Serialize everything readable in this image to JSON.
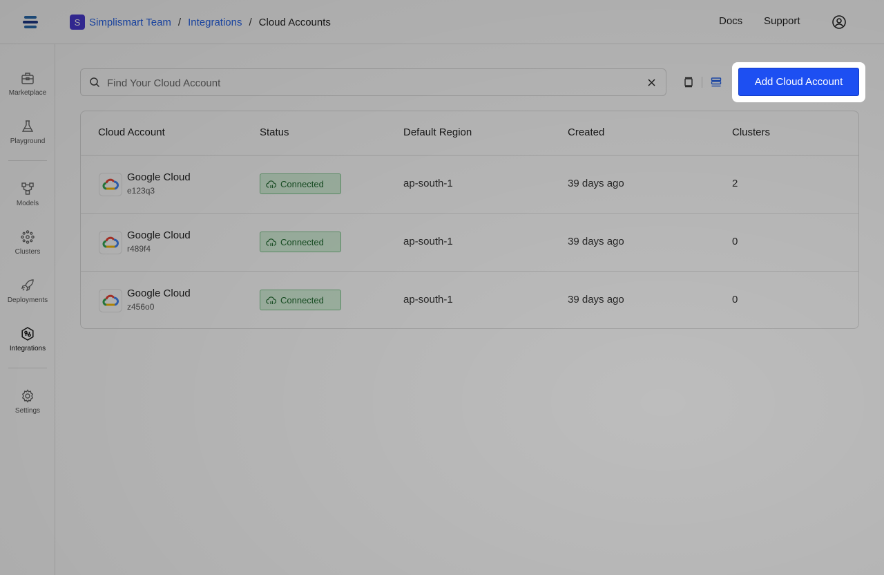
{
  "header": {
    "workspace_initial": "S",
    "breadcrumbs": [
      "Simplismart Team",
      "Integrations",
      "Cloud Accounts"
    ],
    "separator": "/",
    "links": [
      "Docs",
      "Support"
    ]
  },
  "sidebar": {
    "items": [
      {
        "label": "Marketplace",
        "icon": "marketplace-icon"
      },
      {
        "label": "Playground",
        "icon": "flask-icon"
      },
      {
        "label": "Models",
        "icon": "models-icon"
      },
      {
        "label": "Clusters",
        "icon": "clusters-icon"
      },
      {
        "label": "Deployments",
        "icon": "rocket-icon"
      },
      {
        "label": "Integrations",
        "icon": "integrations-icon",
        "active": true
      },
      {
        "label": "Settings",
        "icon": "gear-icon"
      }
    ]
  },
  "search": {
    "placeholder": "Find Your Cloud Account",
    "value": ""
  },
  "view_toggle": {
    "options": [
      "grid",
      "list"
    ],
    "selected": "list"
  },
  "add_button_label": "Add Cloud Account",
  "table": {
    "columns": [
      "Cloud Account",
      "Status",
      "Default Region",
      "Created",
      "Clusters"
    ],
    "rows": [
      {
        "provider": "Google Cloud",
        "id": "e123q3",
        "status": "Connected",
        "region": "ap-south-1",
        "created": "39 days ago",
        "clusters": "2"
      },
      {
        "provider": "Google Cloud",
        "id": "r489f4",
        "status": "Connected",
        "region": "ap-south-1",
        "created": "39 days ago",
        "clusters": "0"
      },
      {
        "provider": "Google Cloud",
        "id": "z456o0",
        "status": "Connected",
        "region": "ap-south-1",
        "created": "39 days ago",
        "clusters": "0"
      }
    ]
  },
  "colors": {
    "accent": "#1d4ff2",
    "link": "#2563eb",
    "workspace_badge": "#4a3bd6",
    "status_connected_bg": "#d6f2db",
    "status_connected_text": "#1f6a2f"
  }
}
